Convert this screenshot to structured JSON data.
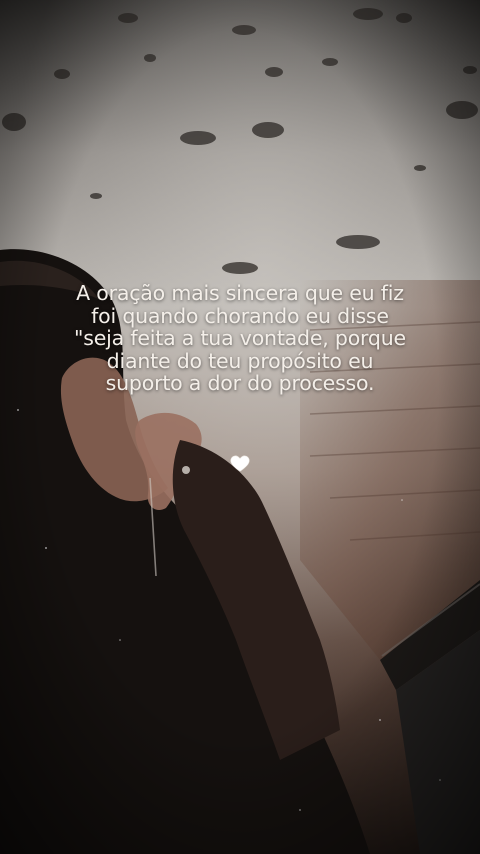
{
  "quote": {
    "lines": [
      "A oração mais sincera que eu fiz",
      "foi quando chorando eu disse",
      "\"seja feita a tua vontade, porque",
      "diante do teu propósito eu",
      "suporto a dor do processo."
    ]
  },
  "decoration": {
    "icon": "white-heart-icon",
    "color": "#ffffff"
  },
  "palette": {
    "sky_top": "#3a3836",
    "window_glass": "#b7b3ae",
    "brick": "#6e4f42",
    "shadow": "#14100e"
  }
}
